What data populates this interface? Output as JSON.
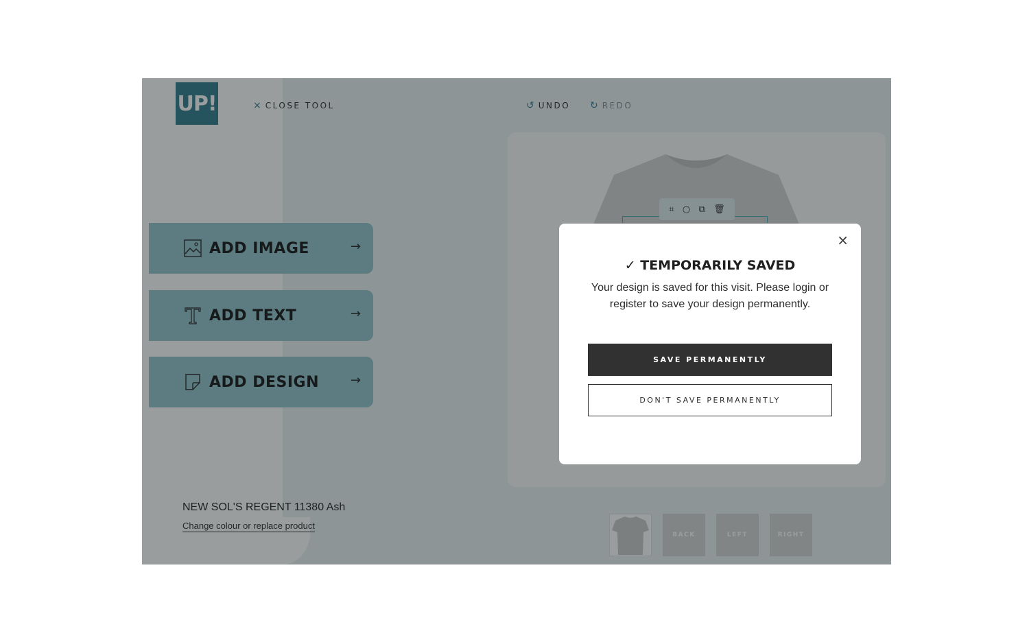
{
  "logo": {
    "text": "UP!"
  },
  "topbar": {
    "close_icon": "×",
    "close_label": "CLOSE TOOL",
    "undo_icon": "↺",
    "undo_label": "UNDO",
    "redo_icon": "↻",
    "redo_label": "REDO"
  },
  "actions": [
    {
      "label": "ADD IMAGE",
      "icon": "image-icon",
      "arrow": "→"
    },
    {
      "label": "ADD TEXT",
      "icon": "text-icon",
      "arrow": "→"
    },
    {
      "label": "ADD DESIGN",
      "icon": "design-icon",
      "arrow": "→"
    }
  ],
  "product": {
    "name": "NEW SOL'S REGENT 11380 Ash",
    "change_link": "Change colour or replace product"
  },
  "views": {
    "front": "",
    "back": "BACK",
    "left": "LEFT",
    "right": "RIGHT"
  },
  "toolbar_icons": [
    "crop-icon",
    "zoom-icon",
    "duplicate-icon",
    "delete-icon"
  ],
  "modal": {
    "close_icon": "×",
    "title": "✓ TEMPORARILY SAVED",
    "body": "Your design is saved for this visit. Please login or register to save your design permanently.",
    "primary_button": "SAVE PERMANENTLY",
    "secondary_button": "DON'T SAVE PERMANENTLY"
  },
  "colors": {
    "brand": "#2b7a8a",
    "action_button": "#8ec3cb",
    "primary_button": "#313131"
  }
}
